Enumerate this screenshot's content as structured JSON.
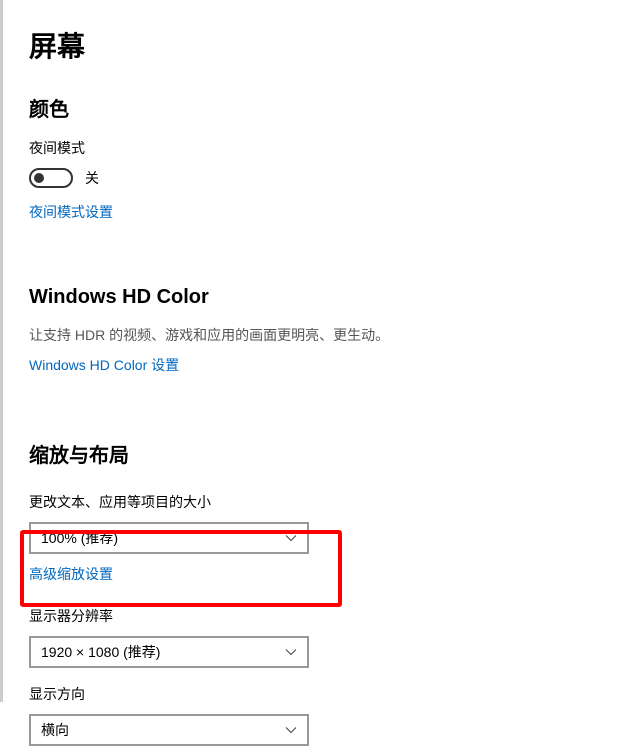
{
  "page_title": "屏幕",
  "color_section": {
    "heading": "颜色",
    "night_light_label": "夜间模式",
    "night_light_state": "关",
    "night_light_settings_link": "夜间模式设置"
  },
  "hd_section": {
    "heading": "Windows HD Color",
    "description": "让支持 HDR 的视频、游戏和应用的画面更明亮、更生动。",
    "settings_link": "Windows HD Color 设置"
  },
  "scale_section": {
    "heading": "缩放与布局",
    "scale_label": "更改文本、应用等项目的大小",
    "scale_value": "100% (推荐)",
    "advanced_scale_link": "高级缩放设置",
    "resolution_label": "显示器分辨率",
    "resolution_value": "1920 × 1080 (推荐)",
    "orientation_label": "显示方向",
    "orientation_value": "横向"
  }
}
